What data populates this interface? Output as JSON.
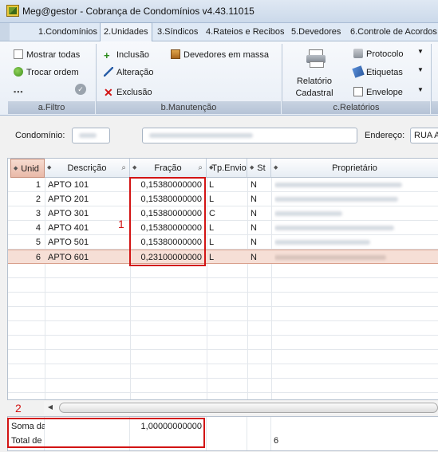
{
  "window": {
    "title": "Meg@gestor - Cobrança de Condomínios v4.43.11015"
  },
  "tabs": [
    {
      "label": "1.Condomínios",
      "active": false
    },
    {
      "label": "2.Unidades",
      "active": true
    },
    {
      "label": "3.Síndicos",
      "active": false
    },
    {
      "label": "4.Rateios e Recibos",
      "active": false
    },
    {
      "label": "5.Devedores",
      "active": false
    },
    {
      "label": "6.Controle de Acordos",
      "active": false
    }
  ],
  "ribbon": {
    "filtro": {
      "label": "a.Filtro",
      "mostrar_todas": "Mostrar todas",
      "trocar_ordem": "Trocar ordem"
    },
    "manutencao": {
      "label": "b.Manutenção",
      "inclusao": "Inclusão",
      "alteracao": "Alteração",
      "exclusao": "Exclusão",
      "devedores": "Devedores em massa"
    },
    "relatorios": {
      "label": "c.Relatórios",
      "relatorio_line1": "Relatório",
      "relatorio_line2": "Cadastral",
      "protocolo": "Protocolo",
      "etiquetas": "Etiquetas",
      "envelope": "Envelope"
    }
  },
  "filter": {
    "condominio_label": "Condomínio:",
    "endereco_label": "Endereço:",
    "endereco_value": "RUA AL"
  },
  "grid": {
    "columns": {
      "unid": "Unid",
      "descricao": "Descrição",
      "fracao": "Fração",
      "tp_envio": "Tp.Envio",
      "st": "St",
      "proprietario": "Proprietário"
    },
    "rows": [
      {
        "unid": "1",
        "descricao": "APTO 101",
        "fracao": "0,15380000000",
        "tp_envio": "L",
        "st": "N",
        "selected": false
      },
      {
        "unid": "2",
        "descricao": "APTO 201",
        "fracao": "0,15380000000",
        "tp_envio": "L",
        "st": "N",
        "selected": false
      },
      {
        "unid": "3",
        "descricao": "APTO 301",
        "fracao": "0,15380000000",
        "tp_envio": "C",
        "st": "N",
        "selected": false
      },
      {
        "unid": "4",
        "descricao": "APTO 401",
        "fracao": "0,15380000000",
        "tp_envio": "L",
        "st": "N",
        "selected": false
      },
      {
        "unid": "5",
        "descricao": "APTO 501",
        "fracao": "0,15380000000",
        "tp_envio": "L",
        "st": "N",
        "selected": false
      },
      {
        "unid": "6",
        "descricao": "APTO 601",
        "fracao": "0,23100000000",
        "tp_envio": "L",
        "st": "N",
        "selected": true
      }
    ]
  },
  "footer": {
    "soma_label": "Soma da",
    "soma_value": "1,00000000000",
    "total_label": "Total de",
    "total_value": "6"
  },
  "annotations": {
    "marker1": "1",
    "marker2": "2"
  },
  "colors": {
    "annotation": "#d21414",
    "selected_row": "#f6dfd6"
  }
}
